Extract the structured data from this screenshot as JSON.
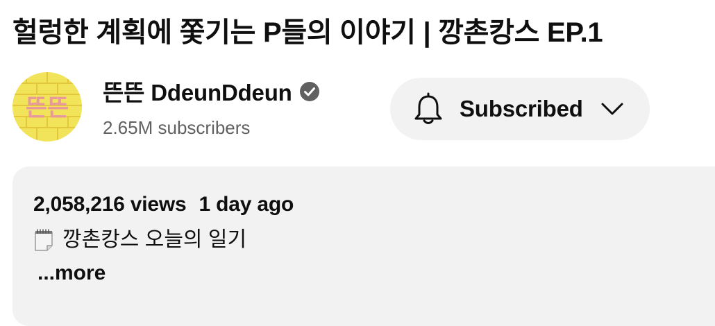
{
  "video": {
    "title": "헐렁한 계획에 쫓기는 P들의 이야기 | 깡촌캉스 EP.1"
  },
  "channel": {
    "name": "뜬뜬 DdeunDdeun",
    "subscribers": "2.65M subscribers",
    "avatar_text": "뜬뜬",
    "verified_icon": "verified-check-icon"
  },
  "subscribe": {
    "label": "Subscribed",
    "bell_icon": "bell-icon",
    "chevron_icon": "chevron-down-icon"
  },
  "description": {
    "views": "2,058,216 views",
    "date": "1 day ago",
    "line1_icon": "notepad-icon",
    "line1": "깡촌캉스 오늘의 일기",
    "more": "...more"
  },
  "colors": {
    "avatar_bg": "#f2e45a",
    "avatar_brick": "#e8c83c",
    "avatar_text": "#e89a9a",
    "button_bg": "#f2f2f2",
    "description_bg": "#f2f2f2",
    "secondary_text": "#606060"
  }
}
